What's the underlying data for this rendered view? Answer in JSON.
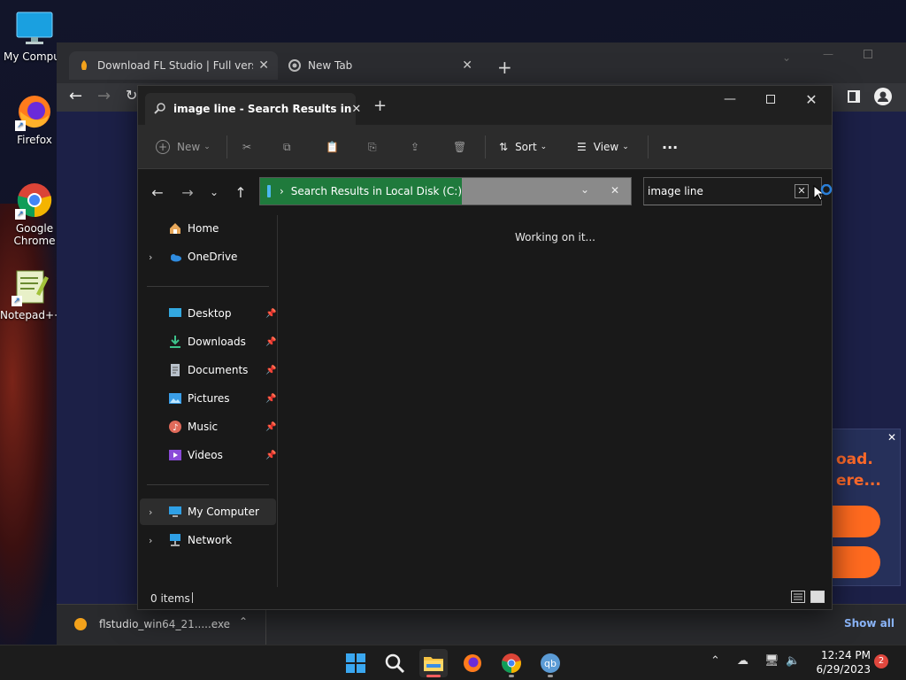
{
  "desktop": {
    "icons": [
      {
        "label": "My Computer",
        "icon": "monitor-icon"
      },
      {
        "label": "Firefox",
        "icon": "firefox-icon"
      },
      {
        "label": "Google Chrome",
        "icon": "chrome-icon"
      },
      {
        "label": "Notepad++",
        "icon": "notepadpp-icon"
      }
    ]
  },
  "browser": {
    "tabs": [
      {
        "label": "Download FL Studio | Full version",
        "icon": "flstudio-icon"
      },
      {
        "label": "New Tab",
        "icon": "chrome-icon"
      }
    ],
    "ad": {
      "line1": "oad.",
      "line2": "ere..."
    },
    "download": {
      "filename": "flstudio_win64_21.....exe",
      "show_all": "Show all"
    }
  },
  "explorer": {
    "tab_title": "image line - Search Results in",
    "commands": {
      "new": "New",
      "sort": "Sort",
      "view": "View",
      "more": "···"
    },
    "address": {
      "path": "Search Results in Local Disk (C:)"
    },
    "search": {
      "value": "image line"
    },
    "nav": {
      "home": "Home",
      "onedrive": "OneDrive",
      "quick_access": [
        {
          "label": "Desktop"
        },
        {
          "label": "Downloads"
        },
        {
          "label": "Documents"
        },
        {
          "label": "Pictures"
        },
        {
          "label": "Music"
        },
        {
          "label": "Videos"
        }
      ],
      "my_computer": "My Computer",
      "network": "Network"
    },
    "content_message": "Working on it...",
    "status": {
      "items": "0 items"
    }
  },
  "taskbar": {
    "clock_time": "12:24 PM",
    "clock_date": "6/29/2023",
    "notifications": "2"
  },
  "colors": {
    "accent_green": "#1f7a3c",
    "explorer_bg": "#191919",
    "taskbar_bg": "#1c1c1c",
    "ad_orange": "#ff6a1f"
  }
}
